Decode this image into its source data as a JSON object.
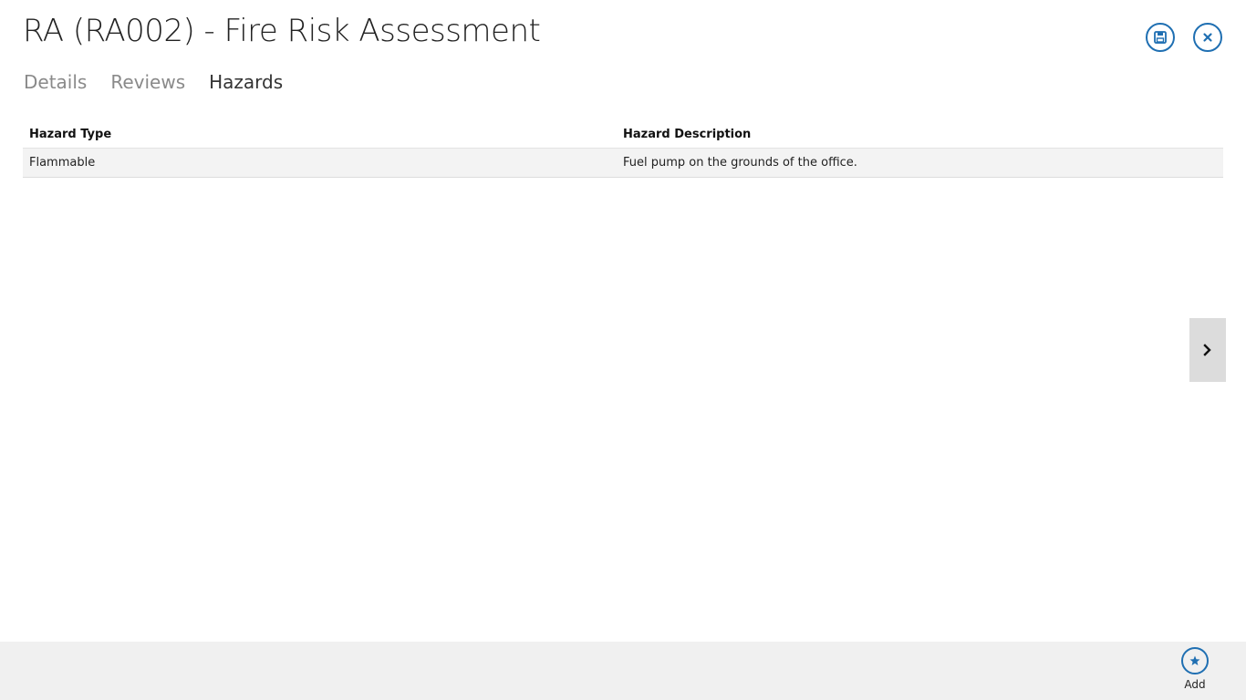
{
  "page": {
    "title": "RA (RA002) - Fire Risk Assessment"
  },
  "header_actions": {
    "save_icon": "save-icon",
    "close_icon": "close-icon"
  },
  "tabs": [
    {
      "label": "Details",
      "active": false
    },
    {
      "label": "Reviews",
      "active": false
    },
    {
      "label": "Hazards",
      "active": true
    }
  ],
  "grid": {
    "columns": [
      "Hazard Type",
      "Hazard Description"
    ],
    "rows": [
      {
        "hazard_type": "Flammable",
        "hazard_description": "Fuel pump on the grounds of the office."
      }
    ]
  },
  "side_nav": {
    "icon": "chevron-right-icon"
  },
  "app_bar": {
    "add_label": "Add",
    "add_icon": "star-icon"
  },
  "colors": {
    "accent": "#1f6fb2",
    "app_bar_bg": "#f0f0f0",
    "row_bg": "#f3f3f3"
  }
}
